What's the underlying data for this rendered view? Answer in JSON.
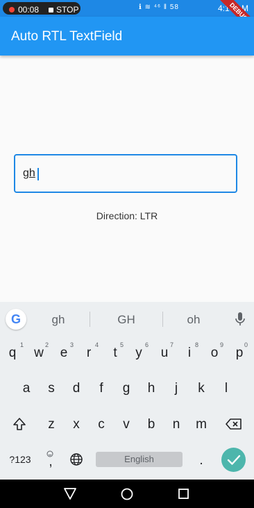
{
  "status_bar": {
    "record_time": "00:08",
    "record_stop": "STOP",
    "icons_text": "ℹ ≋ ⁴⁶ ‖ 58",
    "time": "4:16 AM",
    "debug_banner": "DEBUG"
  },
  "app_bar": {
    "title": "Auto RTL TextField"
  },
  "text_field": {
    "value": "gh"
  },
  "direction_label": "Direction: LTR",
  "keyboard": {
    "suggestions": [
      "gh",
      "GH",
      "oh"
    ],
    "row1": [
      {
        "k": "q",
        "h": "1"
      },
      {
        "k": "w",
        "h": "2"
      },
      {
        "k": "e",
        "h": "3"
      },
      {
        "k": "r",
        "h": "4"
      },
      {
        "k": "t",
        "h": "5"
      },
      {
        "k": "y",
        "h": "6"
      },
      {
        "k": "u",
        "h": "7"
      },
      {
        "k": "i",
        "h": "8"
      },
      {
        "k": "o",
        "h": "9"
      },
      {
        "k": "p",
        "h": "0"
      }
    ],
    "row2": [
      "a",
      "s",
      "d",
      "f",
      "g",
      "h",
      "j",
      "k",
      "l"
    ],
    "row3": [
      "z",
      "x",
      "c",
      "v",
      "b",
      "n",
      "m"
    ],
    "symbols_label": "?123",
    "emoji_comma": ",",
    "space_label": "English",
    "period": "."
  },
  "colors": {
    "primary": "#2196f3",
    "status": "#1e88e5",
    "enter": "#4db6ac"
  },
  "icons": [
    "record-dot-icon",
    "stop-icon",
    "google-g-icon",
    "mic-icon",
    "shift-icon",
    "backspace-icon",
    "emoji-icon",
    "globe-icon",
    "check-icon",
    "back-nav-icon",
    "home-nav-icon",
    "recents-nav-icon"
  ]
}
